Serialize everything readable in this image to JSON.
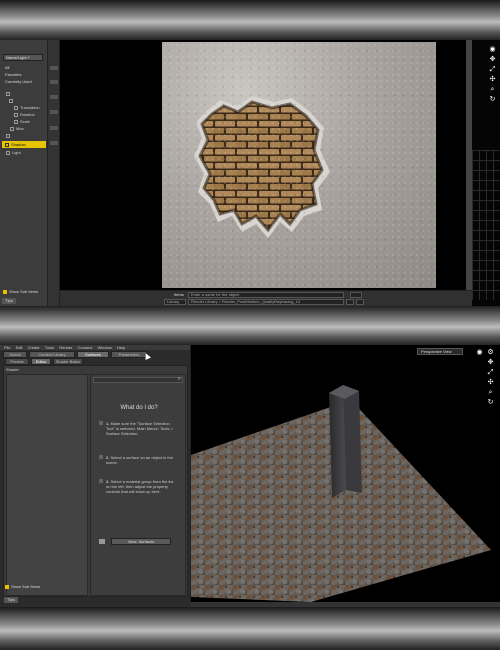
{
  "screenshot1": {
    "dropdown_value": "Name/Light:?",
    "filters": [
      "All",
      "Favorites",
      "Currently Used"
    ],
    "tree": [
      {
        "label": "Translation",
        "indent": 3
      },
      {
        "label": "Rotation",
        "indent": 3
      },
      {
        "label": "Scale",
        "indent": 3
      },
      {
        "label": "Misc",
        "indent": 2
      },
      {
        "label": "Shadow",
        "indent": 1,
        "selected": true
      },
      {
        "label": "Light",
        "indent": 1
      }
    ],
    "show_sub_items": "Show Sub Items",
    "tips": "Tips",
    "bottom": {
      "items_label": "Items",
      "search_placeholder": "Enter a name for the object",
      "library_label": "Library",
      "path": "Render Library > Render_PostMedium_QualityRaytracing_14"
    }
  },
  "screenshot2": {
    "menu": [
      "File",
      "Edit",
      "Create",
      "Tools",
      "Render",
      "Connect",
      "Window",
      "Help"
    ],
    "tabs": [
      "Scene",
      "Content Library",
      "Surfaces",
      "Parameters"
    ],
    "active_tab": "Surfaces",
    "subtabs": [
      "Presets",
      "Editor",
      "Shader Baker"
    ],
    "active_subtab": "Editor",
    "panel_header": "Shader",
    "help_title": "What do I do?",
    "steps": [
      {
        "n": "1.",
        "text": "Make sure the \"Surface Selection Tool\" is selected. Main Menu\\: Tools > Surface Selection."
      },
      {
        "n": "2.",
        "text": "Select a surface on an object in the scene."
      },
      {
        "n": "3.",
        "text": "Select a material group from the list on the left, then adjust the property controls that will show up here."
      }
    ],
    "view_surfaces_button": "View: Surfaces",
    "show_sub_items": "Show Sub Items",
    "tips": "Tips",
    "viewport_label": "Perspective View"
  }
}
